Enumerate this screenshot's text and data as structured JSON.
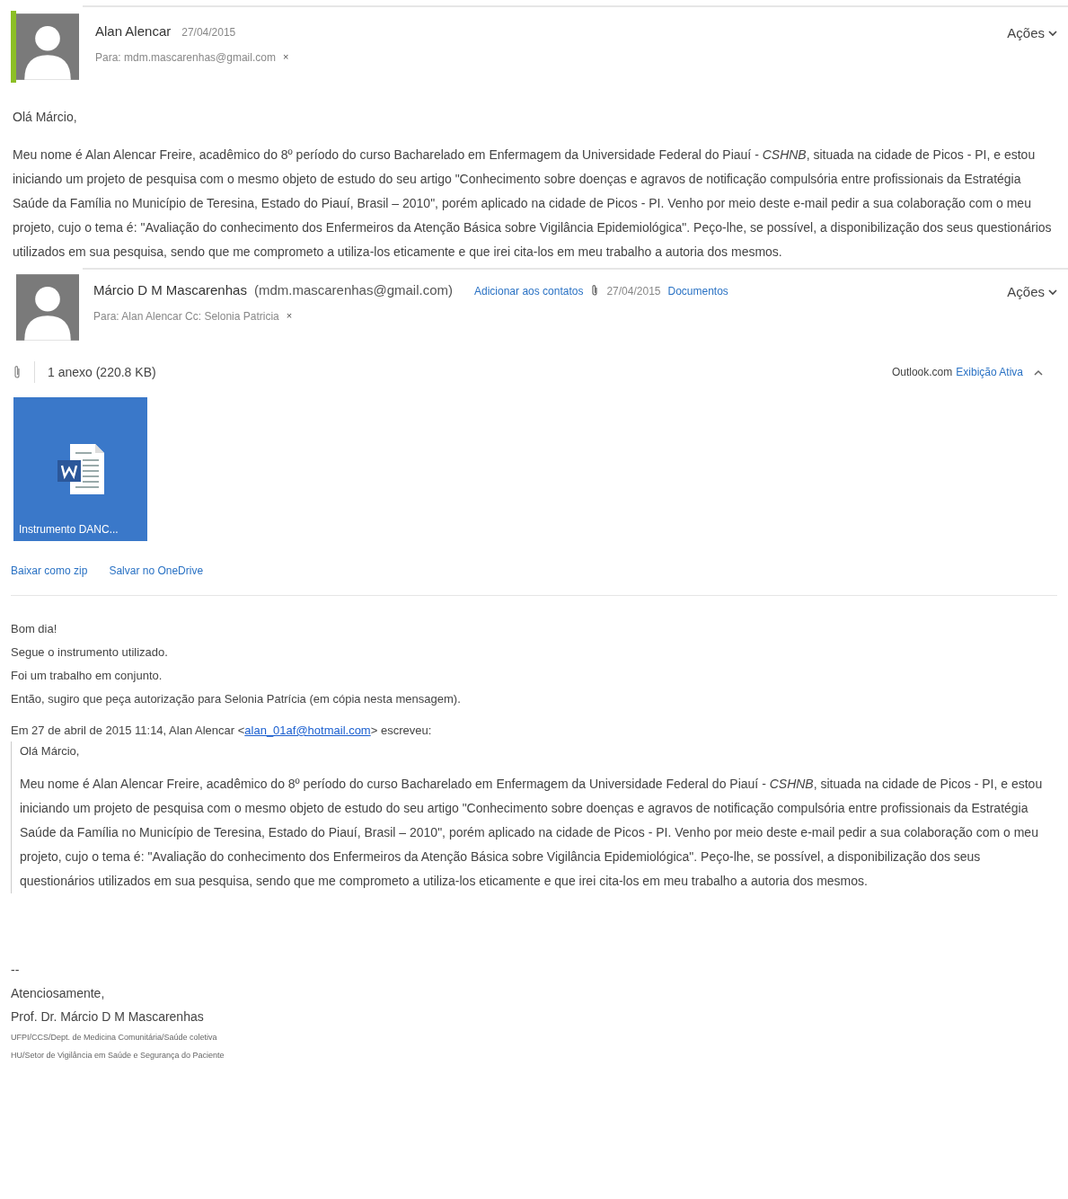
{
  "message": {
    "selected": true,
    "sender": "Alan Alencar",
    "date": "27/04/2015",
    "to": "Para: mdm.mascarenhas@gmail.com",
    "remove_mark": "×",
    "actions": "Ações",
    "greeting": "Olá Márcio,",
    "body": "Meu nome é Alan Alencar Freire, acadêmico do 8º período do curso Bacharelado em Enfermagem da Universidade Federal do Piauí - *CSHNB*, situada na cidade de Picos - PI, e estou iniciando um projeto de pesquisa com o mesmo objeto de estudo do seu artigo \"Conhecimento sobre doenças e agravos de notificação compulsória entre profissionais da Estratégia Saúde da Família no Município de Teresina, Estado do Piauí, Brasil – 2010\", porém aplicado na cidade de Picos - PI. Venho por meio deste e-mail pedir a sua colaboração com o meu projeto, cujo o tema é: \"Avaliação do conhecimento dos Enfermeiros da Atenção Básica sobre Vigilância Epidemiológica\". Peço-lhe, se possível, a disponibilização dos seus questionários utilizados em sua pesquisa, sendo que me comprometo a utiliza-los eticamente e que irei cita-los em meu trabalho a autoria dos mesmos."
  },
  "reply": {
    "selected": false,
    "sender": "Márcio D M Mascarenhas",
    "email": "(mdm.mascarenhas@gmail.com)",
    "add_contact": "Adicionar aos contatos",
    "date": "27/04/2015",
    "folder": "Documentos",
    "to": "Para: Alan Alencar Cc: Selonia Patricia",
    "remove_mark": "×",
    "actions": "Ações",
    "attachments_summary": "1 anexo (220.8 KB)",
    "viewer_label": "Outlook.com",
    "viewer_link": "Exibição Ativa",
    "attachment": {
      "name": "Instrumento DANC..."
    },
    "attachment_links": [
      "Baixar como zip",
      "Salvar no OneDrive"
    ],
    "lines": [
      "Bom dia!",
      "Segue o instrumento utilizado.",
      "Foi um trabalho em conjunto.",
      "Então, sugiro que peça autorização para Selonia Patrícia (em cópia nesta mensagem)."
    ],
    "quote_intro": "Em 27 de abril de 2015 11:14, Alan Alencar <",
    "quote_email": "alan_01af@hotmail.com",
    "quote_intro_end": "> escreveu:",
    "quote_greeting": "Olá Márcio,",
    "quote_body": "Meu nome é Alan Alencar Freire, acadêmico do 8º período do curso Bacharelado em Enfermagem da Universidade Federal do Piauí - *CSHNB*, situada na cidade de Picos - PI, e estou iniciando um projeto de pesquisa com o mesmo objeto de estudo do seu artigo \"Conhecimento sobre doenças e agravos de notificação compulsória entre profissionais da Estratégia Saúde da Família no Município de Teresina, Estado do Piauí, Brasil – 2010\", porém aplicado na cidade de Picos - PI. Venho por meio deste e-mail pedir a sua colaboração com o meu projeto, cujo o tema é: \"Avaliação do conhecimento dos Enfermeiros da Atenção Básica sobre Vigilância Epidemiológica\". Peço-lhe, se possível, a disponibilização dos seus questionários utilizados em sua pesquisa, sendo que me comprometo a utiliza-los eticamente e que irei cita-los em meu trabalho a autoria dos mesmos.",
    "signature": [
      "--",
      "Atenciosamente,",
      "Prof. Dr. Márcio D M Mascarenhas",
      "UFPI/CCS/Dept. de Medicina Comunitária/Saúde coletiva",
      "HU/Setor de Vigilância em Saúde e Segurança do Paciente"
    ]
  }
}
